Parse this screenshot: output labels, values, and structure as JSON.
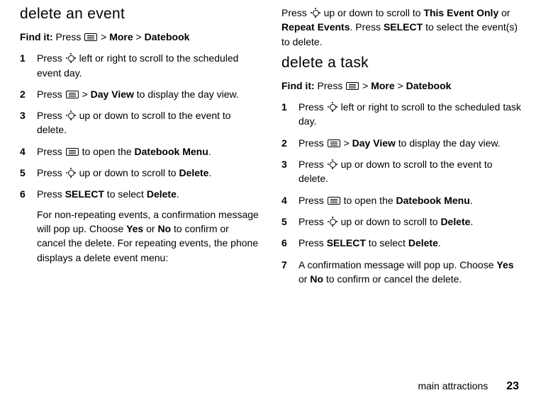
{
  "left": {
    "heading": "delete an event",
    "findit_label": "Find it:",
    "findit_prefix": "Press ",
    "findit_sep": " > ",
    "findit_more": "More",
    "findit_datebook": "Datebook",
    "steps": [
      {
        "num": "1",
        "pre": "Press ",
        "post": " left or right to scroll to the scheduled event day.",
        "icon": "nav"
      },
      {
        "num": "2",
        "pre": "Press ",
        "mid1": " > ",
        "b1": "Day View",
        "post": " to display the day view.",
        "icon": "menu"
      },
      {
        "num": "3",
        "pre": "Press ",
        "post": " up or down to scroll to the event to delete.",
        "icon": "nav"
      },
      {
        "num": "4",
        "pre": "Press ",
        "mid1": " to open the ",
        "b1": "Datebook Menu",
        "post": ".",
        "icon": "menu"
      },
      {
        "num": "5",
        "pre": "Press ",
        "mid1": " up or down to scroll to ",
        "b1": "Delete",
        "post": ".",
        "icon": "nav"
      },
      {
        "num": "6",
        "pre": "Press ",
        "b0": "SELECT",
        "mid1": " to select ",
        "b1": "Delete",
        "post": ".",
        "para_pre": "For non-repeating events, a confirmation message will pop up. Choose ",
        "para_b1": "Yes",
        "para_mid": " or ",
        "para_b2": "No",
        "para_post": " to confirm or cancel the delete. For repeating events, the phone displays a delete event menu:"
      }
    ]
  },
  "right": {
    "cont_pre": "Press ",
    "cont_mid1": " up or down to scroll to ",
    "cont_b1": "This Event Only",
    "cont_mid2": " or ",
    "cont_b2": "Repeat Events",
    "cont_mid3": ". Press ",
    "cont_b3": "SELECT",
    "cont_post": " to select the event(s) to delete.",
    "heading": "delete a task",
    "findit_label": "Find it:",
    "findit_prefix": "Press ",
    "findit_sep": " > ",
    "findit_more": "More",
    "findit_datebook": "Datebook",
    "steps": [
      {
        "num": "1",
        "pre": "Press ",
        "post": " left or right to scroll to the scheduled task day.",
        "icon": "nav"
      },
      {
        "num": "2",
        "pre": "Press ",
        "mid1": " > ",
        "b1": "Day View",
        "post": " to display the day view.",
        "icon": "menu"
      },
      {
        "num": "3",
        "pre": "Press ",
        "post": " up or down to scroll to the event to delete.",
        "icon": "nav"
      },
      {
        "num": "4",
        "pre": "Press ",
        "mid1": " to open the ",
        "b1": "Datebook Menu",
        "post": ".",
        "icon": "menu"
      },
      {
        "num": "5",
        "pre": "Press ",
        "mid1": " up or down to scroll to ",
        "b1": "Delete",
        "post": ".",
        "icon": "nav"
      },
      {
        "num": "6",
        "pre": "Press ",
        "b0": "SELECT",
        "mid1": " to select ",
        "b1": "Delete",
        "post": "."
      },
      {
        "num": "7",
        "para_pre": "A confirmation message will pop up. Choose ",
        "para_b1": "Yes",
        "para_mid": " or ",
        "para_b2": "No",
        "para_post": " to confirm or cancel the delete."
      }
    ]
  },
  "footer": {
    "section": "main attractions",
    "page": "23"
  }
}
